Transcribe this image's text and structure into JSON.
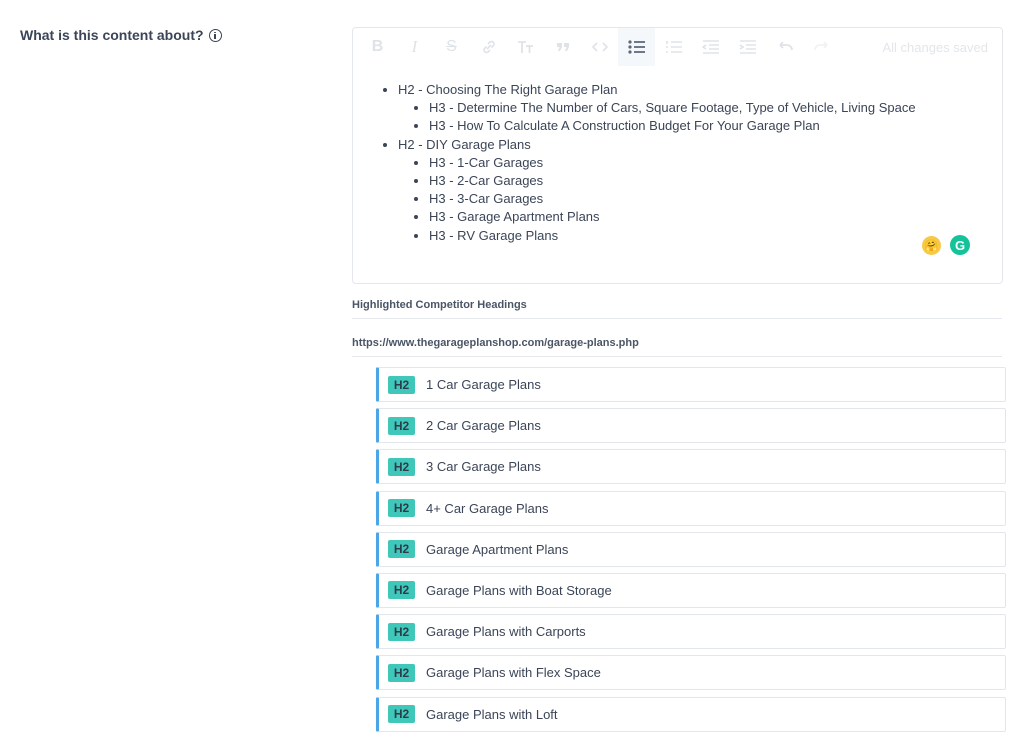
{
  "question": {
    "label": "What is this content about?",
    "info_icon": "info-icon"
  },
  "toolbar": {
    "buttons": [
      {
        "name": "bold",
        "glyph": "B"
      },
      {
        "name": "italic",
        "glyph": "I"
      },
      {
        "name": "strikethrough",
        "glyph": "S"
      },
      {
        "name": "link",
        "glyph": "link-icon"
      },
      {
        "name": "heading",
        "glyph": "heading-icon"
      },
      {
        "name": "quote",
        "glyph": "quote-icon"
      },
      {
        "name": "code",
        "glyph": "code-icon"
      },
      {
        "name": "bulleted-list",
        "glyph": "list-icon"
      },
      {
        "name": "numbered-list",
        "glyph": "ordered-list-icon"
      },
      {
        "name": "outdent",
        "glyph": "outdent-icon"
      },
      {
        "name": "indent",
        "glyph": "indent-icon"
      },
      {
        "name": "undo",
        "glyph": "undo-icon"
      },
      {
        "name": "redo",
        "glyph": "redo-icon"
      }
    ],
    "save_status": "All changes saved"
  },
  "outline": [
    {
      "text": "H2 - Choosing The Right Garage Plan",
      "children": [
        "H3 - Determine The Number of Cars, Square Footage, Type of Vehicle, Living Space",
        "H3 - How To Calculate A Construction Budget For Your Garage Plan"
      ]
    },
    {
      "text": "H2 - DIY Garage Plans",
      "children": [
        "H3 - 1-Car Garages",
        "H3 - 2-Car Garages",
        "H3 - 3-Car Garages",
        "H3 - Garage Apartment Plans",
        "H3 - RV Garage Plans"
      ]
    }
  ],
  "extensions": {
    "emoji": "🤗",
    "grammarly": "G"
  },
  "competitor": {
    "section_title": "Highlighted Competitor Headings",
    "url": "https://www.thegarageplanshop.com/garage-plans.php",
    "headings": [
      {
        "tag": "H2",
        "text": "1 Car Garage Plans"
      },
      {
        "tag": "H2",
        "text": "2 Car Garage Plans"
      },
      {
        "tag": "H2",
        "text": "3 Car Garage Plans"
      },
      {
        "tag": "H2",
        "text": "4+ Car Garage Plans"
      },
      {
        "tag": "H2",
        "text": "Garage Apartment Plans"
      },
      {
        "tag": "H2",
        "text": "Garage Plans with Boat Storage"
      },
      {
        "tag": "H2",
        "text": "Garage Plans with Carports"
      },
      {
        "tag": "H2",
        "text": "Garage Plans with Flex Space"
      },
      {
        "tag": "H2",
        "text": "Garage Plans with Loft"
      }
    ]
  },
  "colors": {
    "tag_bg": "#3fc8b9",
    "row_accent": "#4aa6e6",
    "grammarly": "#15c39a"
  }
}
